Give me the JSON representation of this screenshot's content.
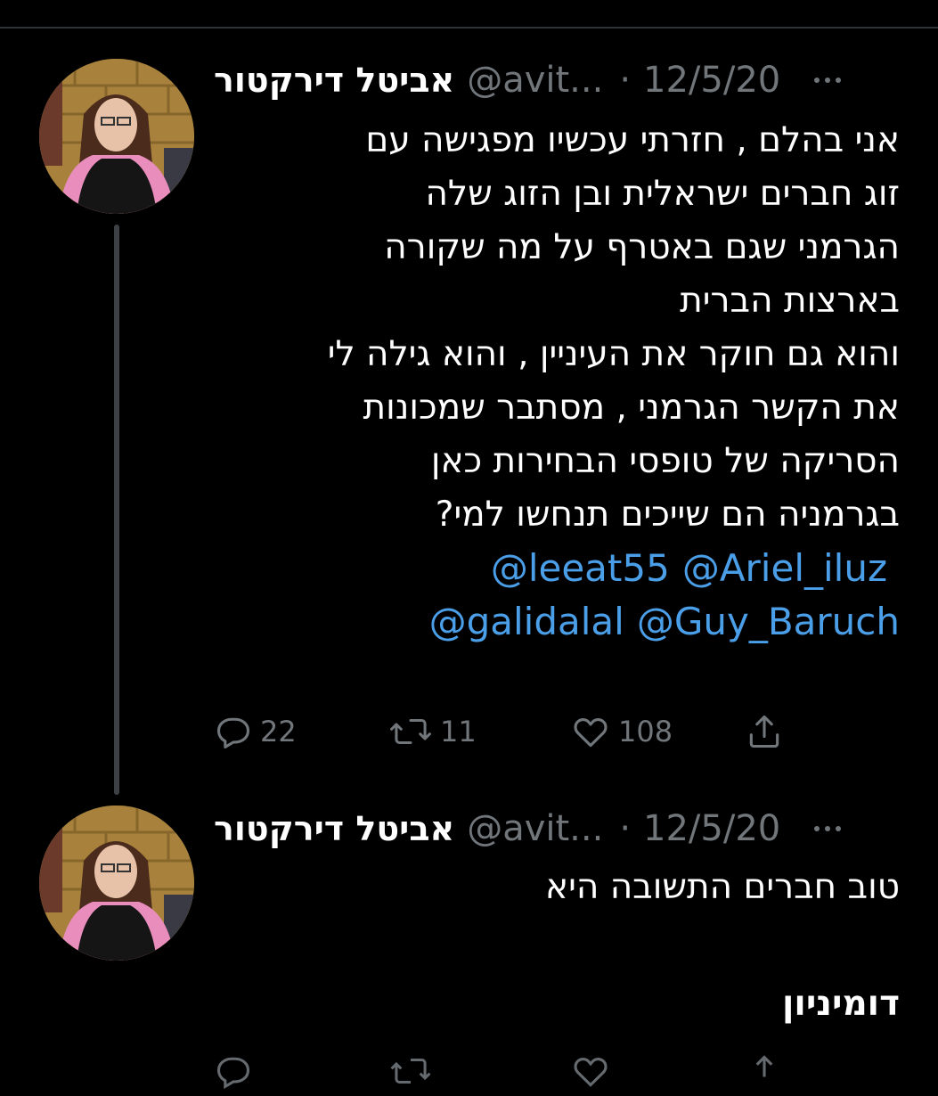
{
  "tweets": [
    {
      "display_name": "אביטל דירקטור",
      "handle": "@avit...",
      "separator": "·",
      "date": "12/5/20",
      "body_lines": [
        "אני בהלם , חזרתי עכשיו מפגישה עם",
        "זוג חברים ישראלית ובן הזוג שלה",
        "הגרמני שגם באטרף על מה שקורה",
        "בארצות הברית",
        "והוא גם חוקר את העיניין , והוא גילה לי",
        "את הקשר הגרמני , מסתבר שמכונות",
        "הסריקה של טופסי הבחירות כאן",
        "בגרמניה הם שייכים תנחשו למי?"
      ],
      "mentions_line_1": [
        "@leeat55",
        "@Ariel_iluz"
      ],
      "mentions_line_2": [
        "@galidalal",
        "@Guy_Baruch"
      ],
      "reply_count": "22",
      "retweet_count": "11",
      "like_count": "108"
    },
    {
      "display_name": "אביטל דירקטור",
      "handle": "@avit...",
      "separator": "·",
      "date": "12/5/20",
      "body_lines": [
        "טוב חברים התשובה היא"
      ],
      "standalone_line": "דומיניון"
    }
  ],
  "icons": {
    "more": "more-icon",
    "reply": "reply-icon",
    "retweet": "retweet-icon",
    "like": "heart-icon",
    "share": "share-icon"
  },
  "colors": {
    "background": "#000000",
    "text": "#ffffff",
    "secondary": "#71767b",
    "mention": "#4a9fe8"
  }
}
